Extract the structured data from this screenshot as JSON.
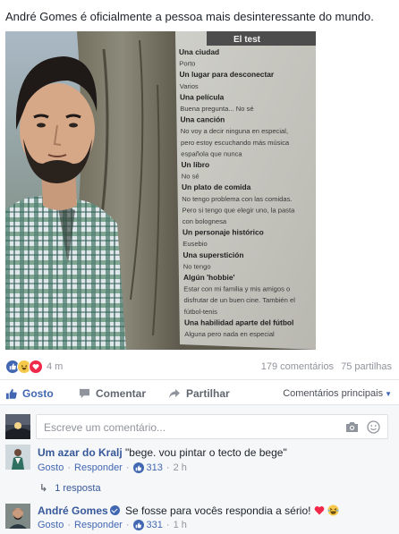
{
  "post": {
    "text": "André Gomes é oficialmente a pessoa mais desinteressante do mundo."
  },
  "magazine": {
    "header": "El test",
    "lines": [
      {
        "t": "Una ciudad",
        "b": true
      },
      {
        "t": "Porto",
        "b": false
      },
      {
        "t": "Un lugar para desconectar",
        "b": true
      },
      {
        "t": "Varios",
        "b": false
      },
      {
        "t": "Una película",
        "b": true
      },
      {
        "t": "Buena pregunta... No sé",
        "b": false
      },
      {
        "t": "Una canción",
        "b": true
      },
      {
        "t": "No voy a decir ninguna en especial,",
        "b": false
      },
      {
        "t": "pero estoy escuchando más música",
        "b": false
      },
      {
        "t": "española que nunca",
        "b": false
      },
      {
        "t": "Un libro",
        "b": true
      },
      {
        "t": "No sé",
        "b": false
      },
      {
        "t": "Un plato de comida",
        "b": true
      },
      {
        "t": "No tengo problema con las comidas.",
        "b": false
      },
      {
        "t": "Pero si tengo que elegir uno, la pasta",
        "b": false
      },
      {
        "t": "con bolognesa",
        "b": false
      },
      {
        "t": "Un personaje histórico",
        "b": true
      },
      {
        "t": "Eusebio",
        "b": false
      },
      {
        "t": "Una superstición",
        "b": true
      },
      {
        "t": "No tengo",
        "b": false
      },
      {
        "t": "Algún 'hobbie'",
        "b": true
      },
      {
        "t": "Estar con mi familia y mis amigos o",
        "b": false
      },
      {
        "t": "disfrutar de un buen cine. También el",
        "b": false
      },
      {
        "t": "fútbol-tenis",
        "b": false
      },
      {
        "t": "Una habilidad aparte del fútbol",
        "b": true
      },
      {
        "t": "Alguna pero nada en especial",
        "b": false
      }
    ]
  },
  "reactions": {
    "time": "4 m",
    "comments": "179 comentários",
    "shares": "75 partilhas"
  },
  "actions": {
    "like": "Gosto",
    "comment": "Comentar",
    "share": "Partilhar",
    "sort": "Comentários principais"
  },
  "composer": {
    "placeholder": "Escreve um comentário..."
  },
  "comments": [
    {
      "author": "Um azar do Kralj",
      "text": "\"bege. vou pintar o tecto de bege\"",
      "like": "Gosto",
      "reply": "Responder",
      "likes": "313",
      "time": "2 h",
      "replies": "1 resposta"
    },
    {
      "author": "André Gomes",
      "text": "Se fosse para vocês respondia a sério!",
      "like": "Gosto",
      "reply": "Responder",
      "likes": "331",
      "time": "1 h"
    }
  ],
  "colors": {
    "fb_blue": "#4267b2",
    "link_blue": "#365899",
    "muted": "#90949c",
    "love": "#f0284a"
  }
}
